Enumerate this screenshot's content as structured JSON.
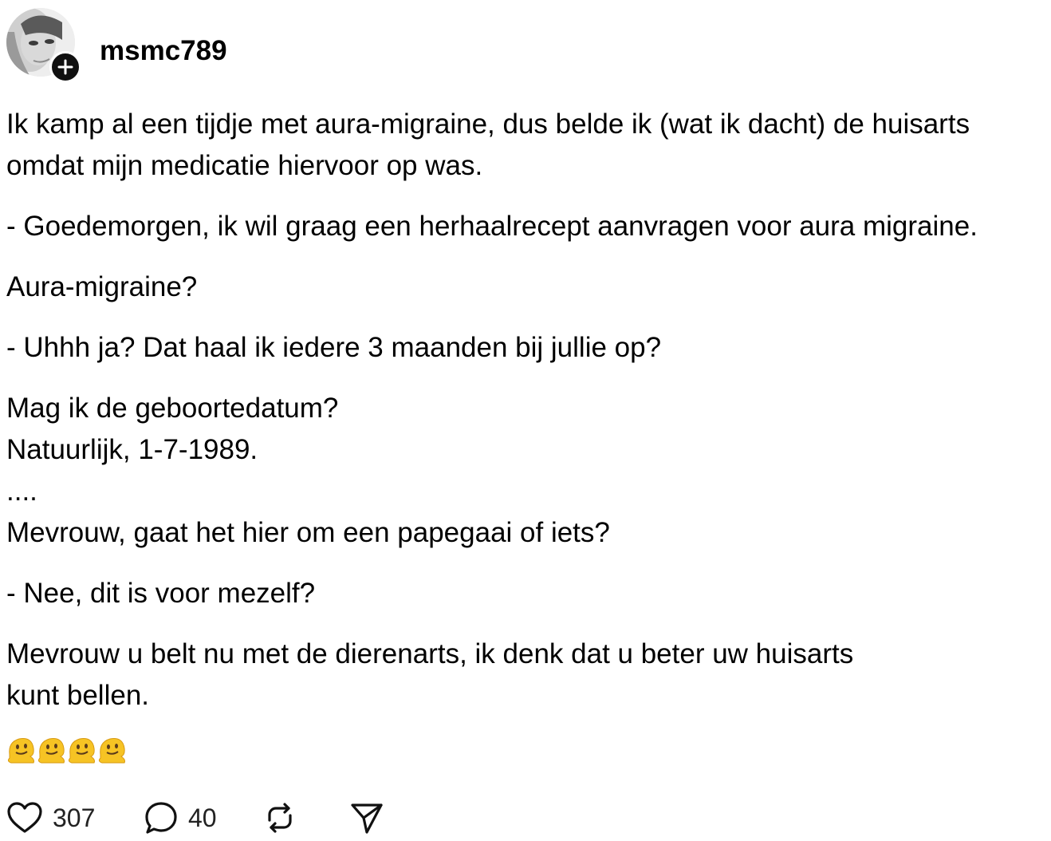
{
  "author": {
    "username": "msmc789"
  },
  "post": {
    "lines": [
      "Ik kamp al een tijdje met aura-migraine, dus belde ik (wat ik dacht) de huisarts",
      "omdat mijn medicatie hiervoor op was.",
      "",
      "- Goedemorgen, ik wil graag een herhaalrecept aanvragen voor aura migraine.",
      "",
      "Aura-migraine?",
      "",
      "- Uhhh ja? Dat haal ik iedere 3 maanden bij jullie op?",
      "",
      "Mag ik de geboortedatum?",
      "Natuurlijk, 1-7-1989.",
      "....",
      "Mevrouw, gaat het hier om een papegaai of iets?",
      "",
      "- Nee, dit is voor mezelf?",
      "",
      "Mevrouw u belt nu met de dierenarts, ik denk dat u beter uw huisarts",
      "kunt bellen."
    ],
    "emojis": [
      "melting-face",
      "melting-face",
      "melting-face",
      "melting-face"
    ]
  },
  "actions": {
    "likes": "307",
    "replies": "40"
  },
  "icons": {
    "like": "heart-icon",
    "reply": "speech-bubble-icon",
    "repost": "repost-icon",
    "share": "send-icon",
    "follow": "plus-icon"
  },
  "colors": {
    "text": "#000000",
    "badge": "#101010",
    "emoji": "#F6C324"
  }
}
